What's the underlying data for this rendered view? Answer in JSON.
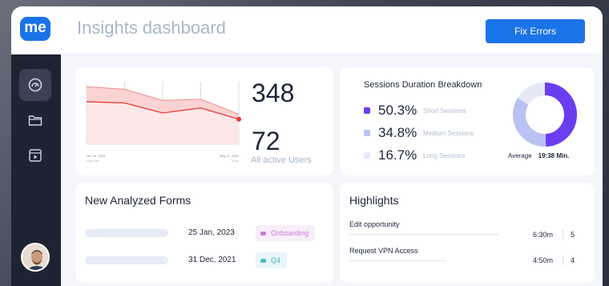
{
  "header": {
    "logo_text": "me",
    "title": "Insights dashboard",
    "fix_button": "Fix Errors"
  },
  "sidebar": {
    "items": [
      {
        "icon": "gauge-icon",
        "active": true
      },
      {
        "icon": "folder-icon",
        "active": false
      },
      {
        "icon": "video-file-icon",
        "active": false
      }
    ],
    "avatar_icon": "user-avatar"
  },
  "users_card": {
    "total": "348",
    "active": "72",
    "active_label": "All active Users",
    "start_date": "Jan 18, 2023",
    "start_sub": "Start Date",
    "end_date": "May 11, 2023",
    "end_sub": "Today"
  },
  "chart_data": {
    "type": "area",
    "x": [
      0,
      1,
      2,
      3,
      4
    ],
    "series": [
      {
        "values": [
          92,
          88,
          70,
          72,
          48
        ],
        "color": "#f5a1a1"
      },
      {
        "values": [
          68,
          66,
          50,
          58,
          40
        ],
        "color": "#e53935"
      }
    ],
    "grid": true,
    "colors": {
      "line": "#e53935",
      "fill": "#fbd3d3"
    }
  },
  "sessions": {
    "title": "Sessions Duration Breakdown",
    "rows": [
      {
        "pct": "50.3%",
        "label": "Short Sessions",
        "color": "#6a3df0",
        "value": 50.3
      },
      {
        "pct": "34.8%",
        "label": "Medium Sessions",
        "color": "#b9c2f2",
        "value": 34.8
      },
      {
        "pct": "16.7%",
        "label": "Long Sessions",
        "color": "#e5e9f6",
        "value": 16.7
      }
    ],
    "average_label": "Average",
    "average_value": "19:38 Min."
  },
  "forms": {
    "title": "New Analyzed Forms",
    "rows": [
      {
        "date": "25 Jan, 2023",
        "tag": "Onboarding",
        "tag_color": "#c77ddb",
        "tag_bg": "#f7eefa"
      },
      {
        "date": "31 Dec, 2021",
        "tag": "Q4",
        "tag_color": "#4bb7c9",
        "tag_bg": "#e9f6f8"
      }
    ]
  },
  "highlights": {
    "title": "Highlights",
    "rows": [
      {
        "label": "Edit opportunity",
        "time": "6:30m",
        "count": "5"
      },
      {
        "label": "Request VPN Access",
        "time": "4:50m",
        "count": "4"
      }
    ]
  },
  "colors": {
    "brand": "#1a73e8",
    "sidebar": "#1d2333",
    "accent_red": "#e53935"
  }
}
